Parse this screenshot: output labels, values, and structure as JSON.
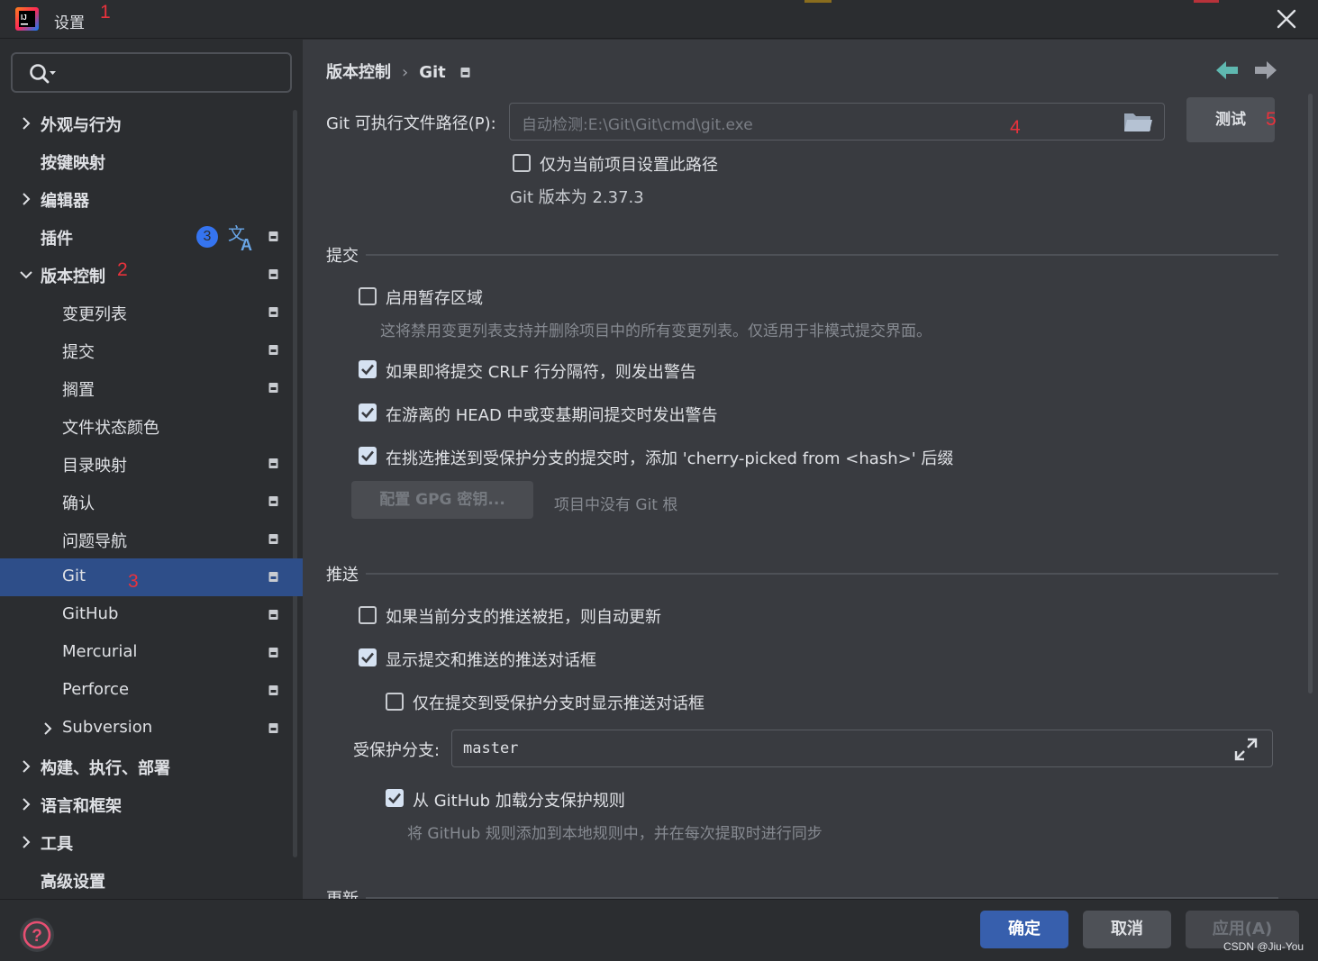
{
  "window": {
    "title": "设置",
    "close_icon": "close-icon"
  },
  "annotations": [
    "1",
    "2",
    "3",
    "4",
    "5"
  ],
  "search": {
    "placeholder": "",
    "icon": "search-icon"
  },
  "sidebar": {
    "items": [
      {
        "label": "外观与行为",
        "expandable": true,
        "expanded": false,
        "bold": true
      },
      {
        "label": "按键映射",
        "bold": true
      },
      {
        "label": "编辑器",
        "expandable": true,
        "expanded": false,
        "bold": true
      },
      {
        "label": "插件",
        "bold": true,
        "badge": "3",
        "translate_icon": "translate-icon",
        "pinned": true
      },
      {
        "label": "版本控制",
        "expandable": true,
        "expanded": true,
        "bold": true,
        "pinned": true
      },
      {
        "label": "变更列表",
        "pinned": true
      },
      {
        "label": "提交",
        "pinned": true
      },
      {
        "label": "搁置",
        "pinned": true
      },
      {
        "label": "文件状态颜色"
      },
      {
        "label": "目录映射",
        "pinned": true
      },
      {
        "label": "确认",
        "pinned": true
      },
      {
        "label": "问题导航",
        "pinned": true
      },
      {
        "label": "Git",
        "pinned": true,
        "selected": true
      },
      {
        "label": "GitHub",
        "pinned": true
      },
      {
        "label": "Mercurial",
        "pinned": true
      },
      {
        "label": "Perforce",
        "pinned": true
      },
      {
        "label": "Subversion",
        "expandable": true,
        "expanded": false,
        "pinned": true
      },
      {
        "label": "构建、执行、部署",
        "expandable": true,
        "expanded": false,
        "bold": true
      },
      {
        "label": "语言和框架",
        "expandable": true,
        "expanded": false,
        "bold": true
      },
      {
        "label": "工具",
        "expandable": true,
        "expanded": false,
        "bold": true
      },
      {
        "label": "高级设置",
        "bold": true
      }
    ]
  },
  "breadcrumb": {
    "parent": "版本控制",
    "separator": "›",
    "current": "Git"
  },
  "git_path": {
    "label": "Git 可执行文件路径(P):",
    "placeholder": "自动检测:E:\\Git\\Git\\cmd\\git.exe",
    "browse_icon": "folder-icon",
    "test_button": "测试",
    "project_only_label": "仅为当前项目设置此路径",
    "project_only_checked": false,
    "version_text": "Git 版本为 2.37.3"
  },
  "commit_section": {
    "title": "提交",
    "staging_label": "启用暂存区域",
    "staging_checked": false,
    "staging_hint": "这将禁用变更列表支持并删除项目中的所有变更列表。仅适用于非模式提交界面。",
    "crlf_label": "如果即将提交 CRLF 行分隔符，则发出警告",
    "crlf_checked": true,
    "head_label": "在游离的 HEAD 中或变基期间提交时发出警告",
    "head_checked": true,
    "cherry_label": "在挑选推送到受保护分支的提交时，添加 'cherry-picked from <hash>' 后缀",
    "cherry_checked": true,
    "gpg_button": "配置 GPG 密钥...",
    "gpg_hint": "项目中没有 Git 根"
  },
  "push_section": {
    "title": "推送",
    "auto_update_label": "如果当前分支的推送被拒，则自动更新",
    "auto_update_checked": false,
    "show_dialog_label": "显示提交和推送的推送对话框",
    "show_dialog_checked": true,
    "protected_only_label": "仅在提交到受保护分支时显示推送对话框",
    "protected_only_checked": false,
    "protected_branches_label": "受保护分支:",
    "protected_branches_value": "master",
    "expand_icon": "expand-icon",
    "github_rules_label": "从 GitHub 加载分支保护规则",
    "github_rules_checked": true,
    "github_rules_hint": "将 GitHub 规则添加到本地规则中，并在每次提取时进行同步"
  },
  "update_section": {
    "title": "更新"
  },
  "footer": {
    "help_icon": "help-icon",
    "ok": "确定",
    "cancel": "取消",
    "apply": "应用(A)",
    "watermark": "CSDN @Jiu-You"
  },
  "colors": {
    "accent": "#3574f0",
    "selection": "#2e4e89",
    "annotation": "#e8323c",
    "nav_arrow_active": "#5fb8b0"
  }
}
